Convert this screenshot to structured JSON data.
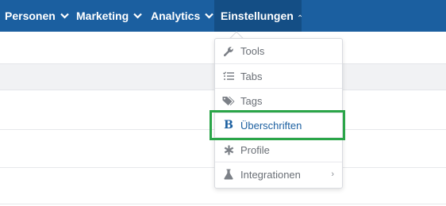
{
  "topnav": {
    "items": [
      {
        "label": "Personen"
      },
      {
        "label": "Marketing"
      },
      {
        "label": "Analytics"
      },
      {
        "label": "Einstellungen"
      }
    ]
  },
  "dropdown": {
    "items": [
      {
        "label": "Tools",
        "icon": "wrench-icon"
      },
      {
        "label": "Tabs",
        "icon": "checklist-icon"
      },
      {
        "label": "Tags",
        "icon": "tags-icon"
      },
      {
        "label": "Überschriften",
        "icon": "bold-icon"
      },
      {
        "label": "Profile",
        "icon": "asterisk-icon"
      },
      {
        "label": "Integrationen",
        "icon": "flask-icon"
      }
    ]
  },
  "colors": {
    "nav_bg": "#1b5fa0",
    "highlight": "#2aa548"
  }
}
